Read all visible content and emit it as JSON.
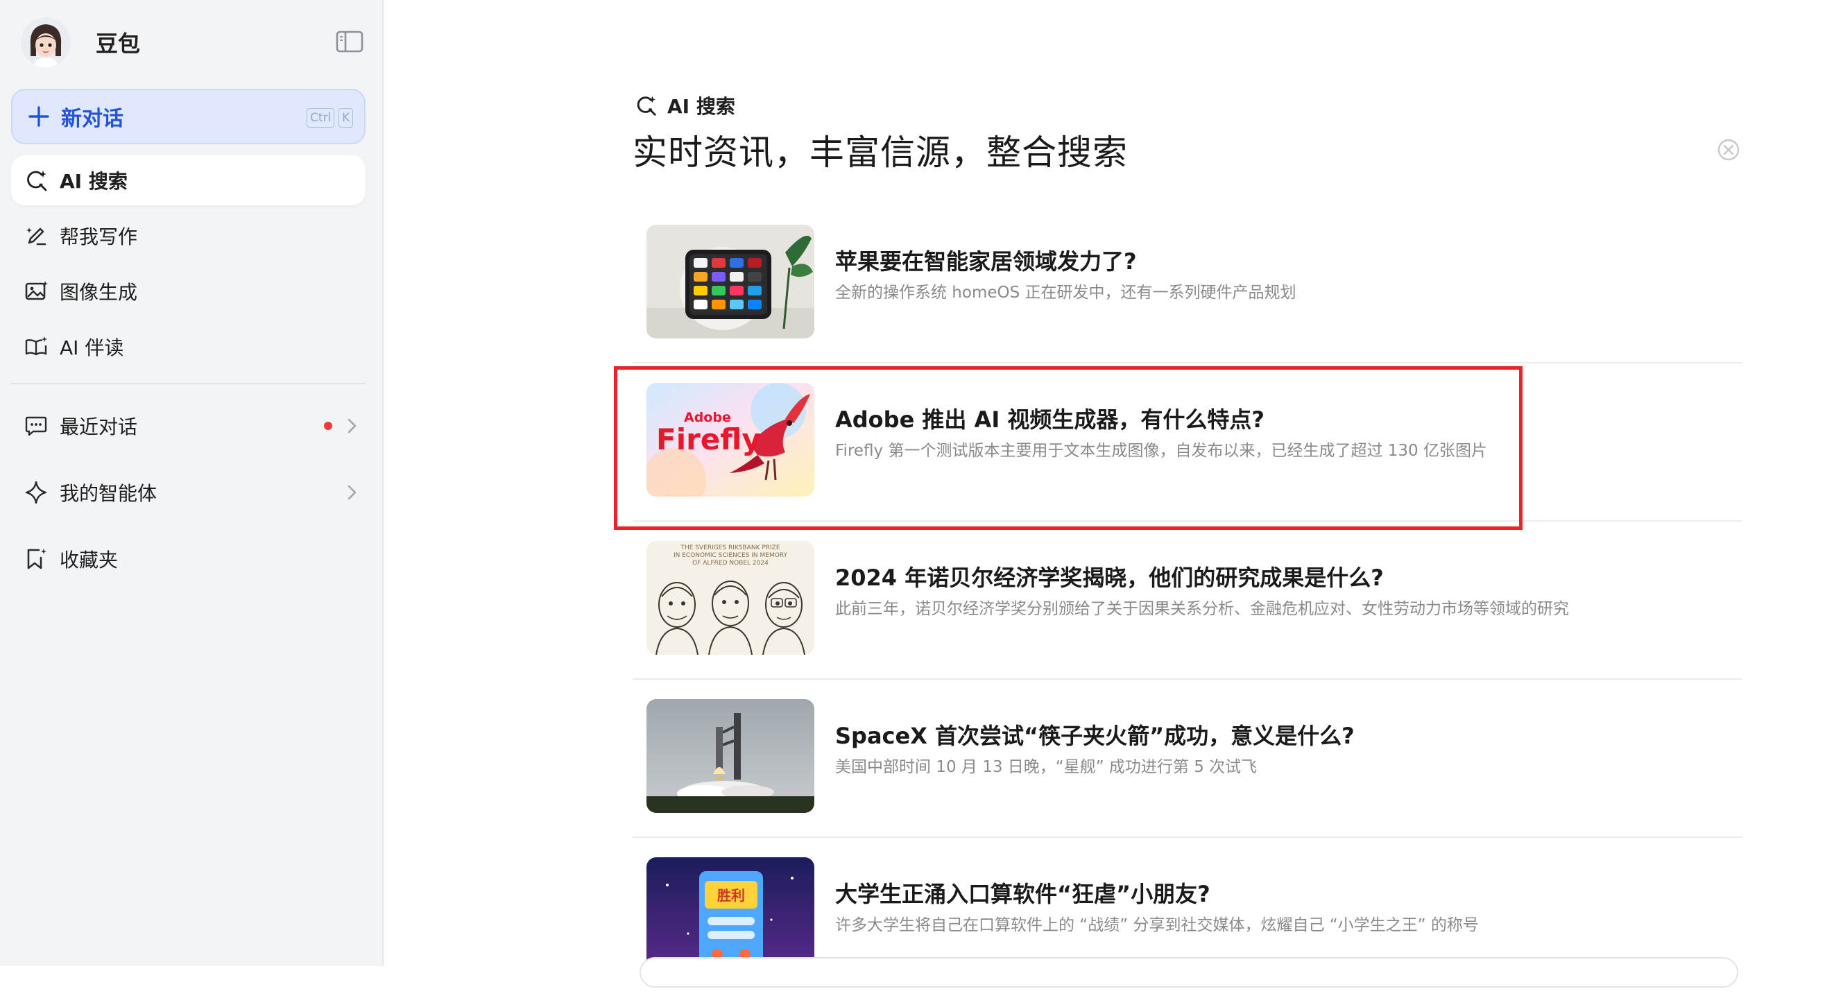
{
  "sidebar": {
    "brand_name": "豆包",
    "new_chat": {
      "label": "新对话",
      "shortcut_ctrl": "Ctrl",
      "shortcut_key": "K"
    },
    "nav": [
      {
        "label": "AI 搜索",
        "icon": "ai-search-icon",
        "active": true
      },
      {
        "label": "帮我写作",
        "icon": "pen-icon"
      },
      {
        "label": "图像生成",
        "icon": "image-icon"
      },
      {
        "label": "AI 伴读",
        "icon": "book-icon"
      }
    ],
    "recent_chats": {
      "label": "最近对话",
      "has_unread": true
    },
    "my_agents": {
      "label": "我的智能体"
    },
    "favorites": {
      "label": "收藏夹"
    }
  },
  "main": {
    "section_label": "AI 搜索",
    "headline": "实时资讯，丰富信源，整合搜索",
    "articles": [
      {
        "title": "苹果要在智能家居领域发力了?",
        "desc": "全新的操作系统 homeOS 正在研发中，还有一系列硬件产品规划"
      },
      {
        "title": "Adobe 推出 AI 视频生成器，有什么特点?",
        "desc": "Firefly 第一个测试版本主要用于文本生成图像，自发布以来，已经生成了超过 130 亿张图片",
        "thumb_text_small": "Adobe",
        "thumb_text_big": "Firefly"
      },
      {
        "title": "2024 年诺贝尔经济学奖揭晓，他们的研究成果是什么?",
        "desc": "此前三年，诺贝尔经济学奖分别颁给了关于因果关系分析、金融危机应对、女性劳动力市场等领域的研究",
        "thumb_caption_1": "THE SVERIGES RIKSBANK PRIZE",
        "thumb_caption_2": "IN ECONOMIC SCIENCES IN MEMORY",
        "thumb_caption_3": "OF ALFRED NOBEL 2024"
      },
      {
        "title": "SpaceX 首次尝试“筷子夹火箭”成功，意义是什么?",
        "desc": "美国中部时间 10 月 13 日晚，“星舰” 成功进行第 5 次试飞"
      },
      {
        "title": "大学生正涌入口算软件“狂虐”小朋友?",
        "desc": "许多大学生将自己在口算软件上的 “战绩” 分享到社交媒体，炫耀自己 “小学生之王” 的称号",
        "thumb_text": "胜利"
      }
    ]
  },
  "colors": {
    "accent": "#2453d9",
    "highlight_box": "#e8232a",
    "sidebar_bg": "#f3f4f6"
  }
}
